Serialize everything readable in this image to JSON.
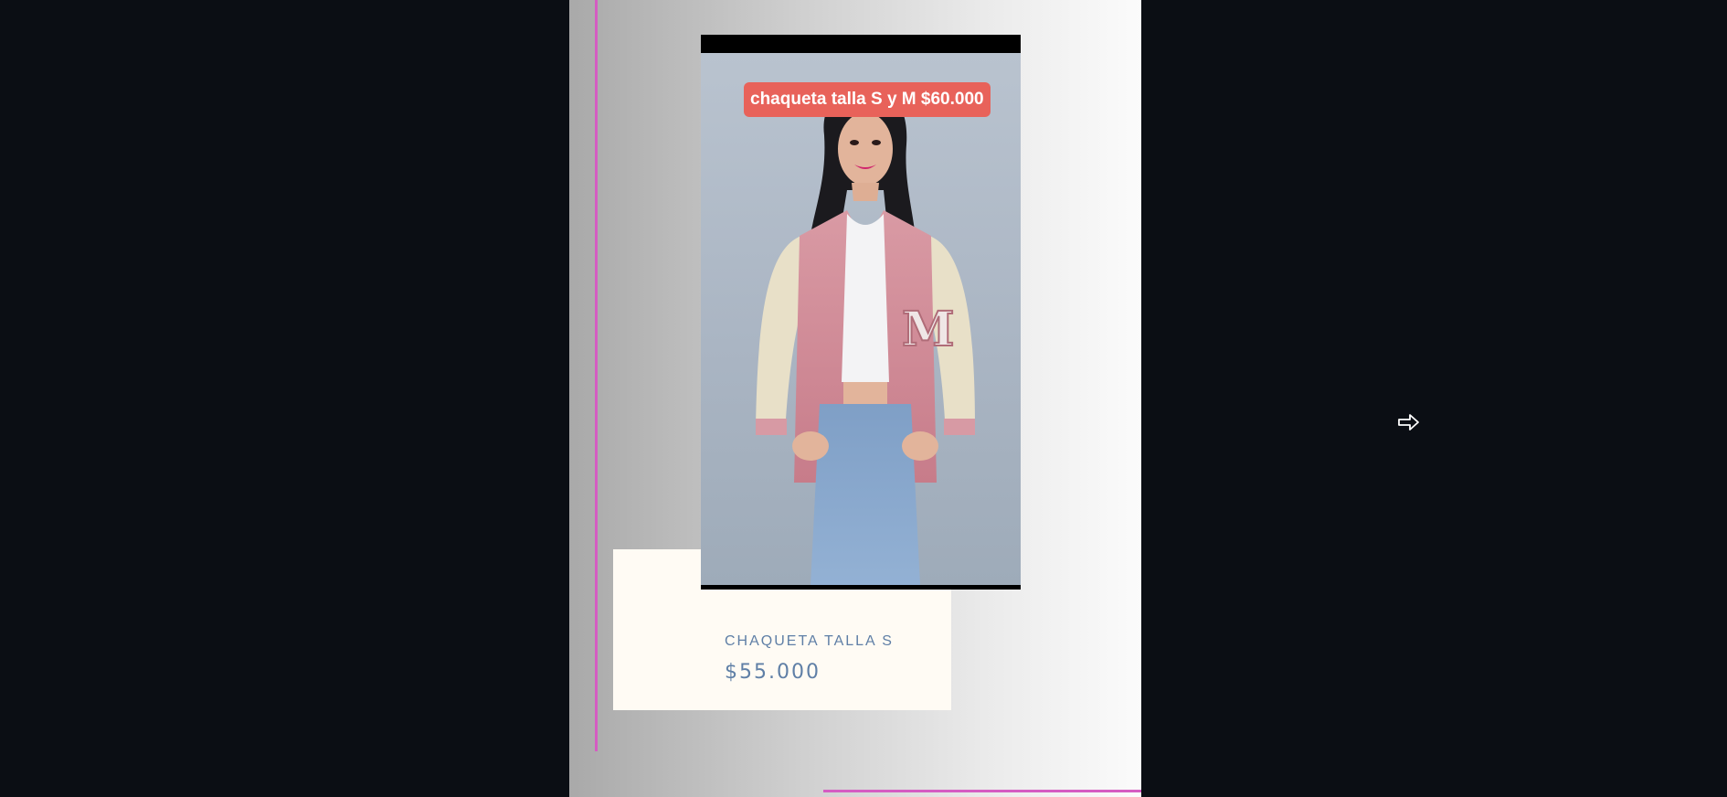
{
  "product": {
    "name": "CHAQUETA TALLA S",
    "price": "$55.000",
    "image_caption": "chaqueta talla S y M $60.000",
    "image_alt": "chaqueta talla S"
  },
  "navigation": {
    "next_icon": "arrow-right-icon"
  },
  "colors": {
    "background": "#0b0e14",
    "accent": "#d55cc2",
    "card_background": "#fffbf4",
    "product_text": "#5f7fa6",
    "caption_background": "#e8625a"
  }
}
